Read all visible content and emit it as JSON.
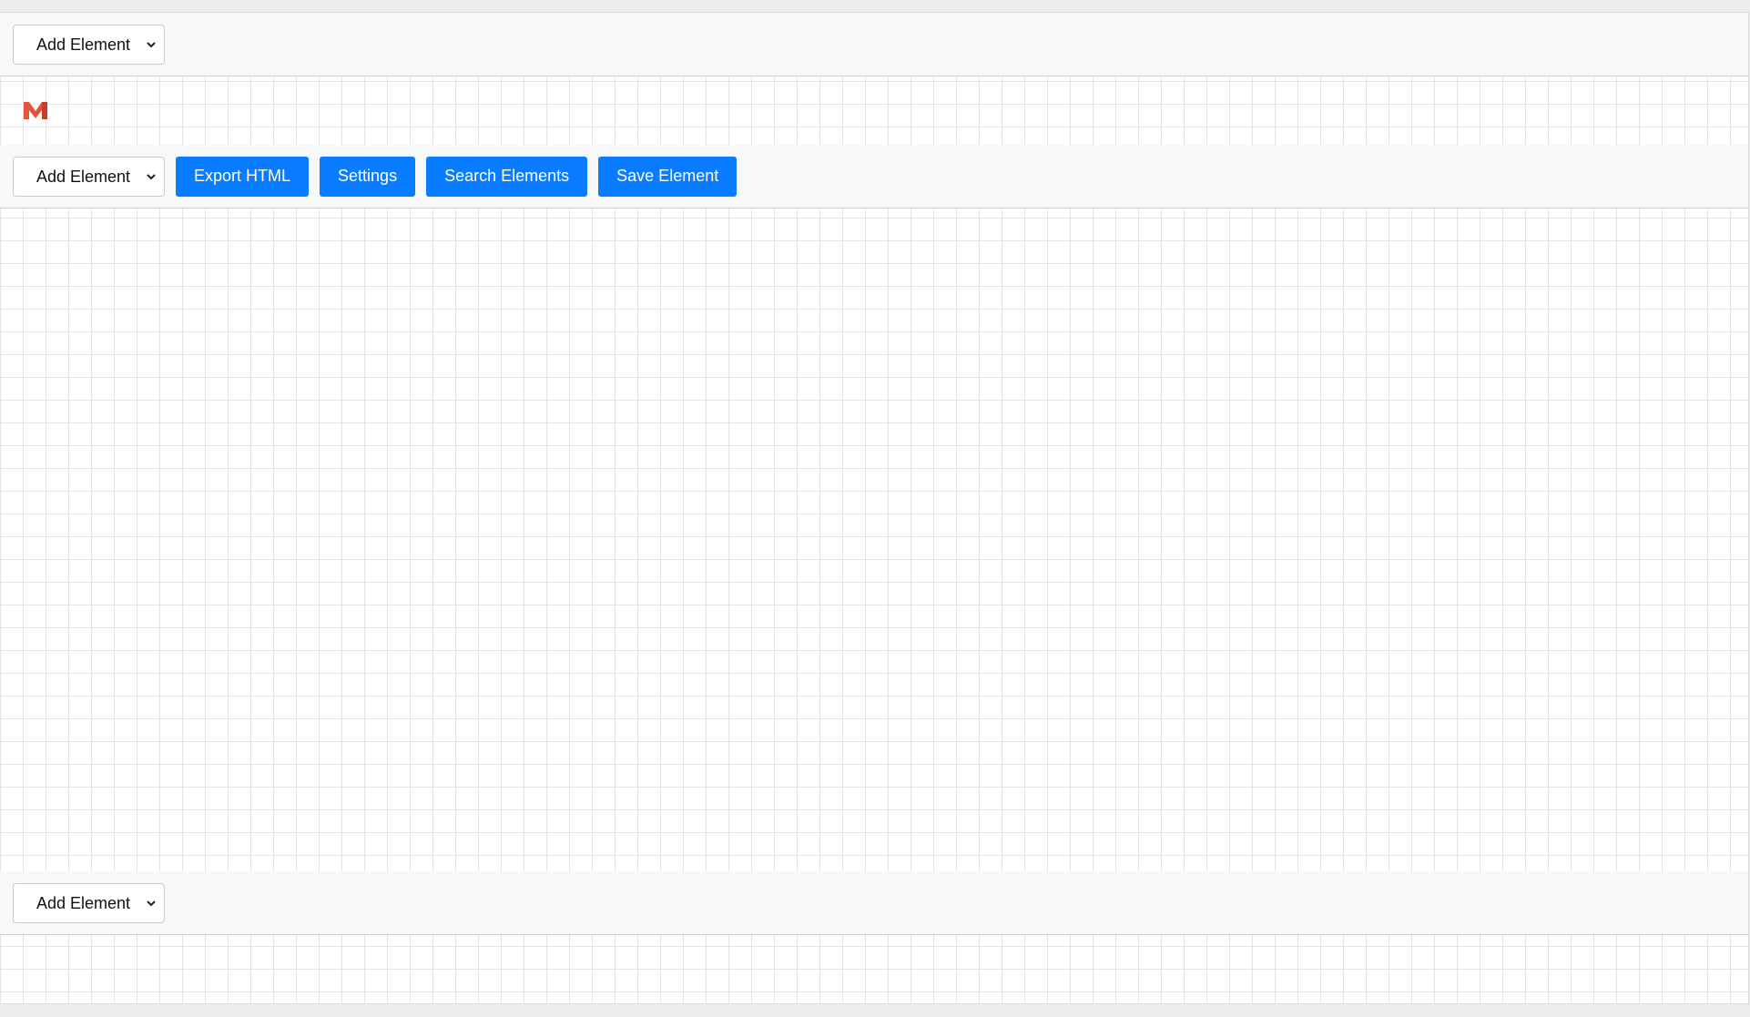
{
  "toolbar_top": {
    "add_element_selected": "Add Element"
  },
  "logo": {
    "icon": "m-logo-icon"
  },
  "toolbar_main": {
    "add_element_selected": "Add Element",
    "export_label": "Export HTML",
    "settings_label": "Settings",
    "search_label": "Search Elements",
    "save_label": "Save Element"
  },
  "toolbar_bottom": {
    "add_element_selected": "Add Element"
  },
  "colors": {
    "accent": "#0a7cff",
    "toolbar_bg": "#f7f8f9",
    "grid_line": "#e4e4e4",
    "logo_red": "#e4533b"
  }
}
